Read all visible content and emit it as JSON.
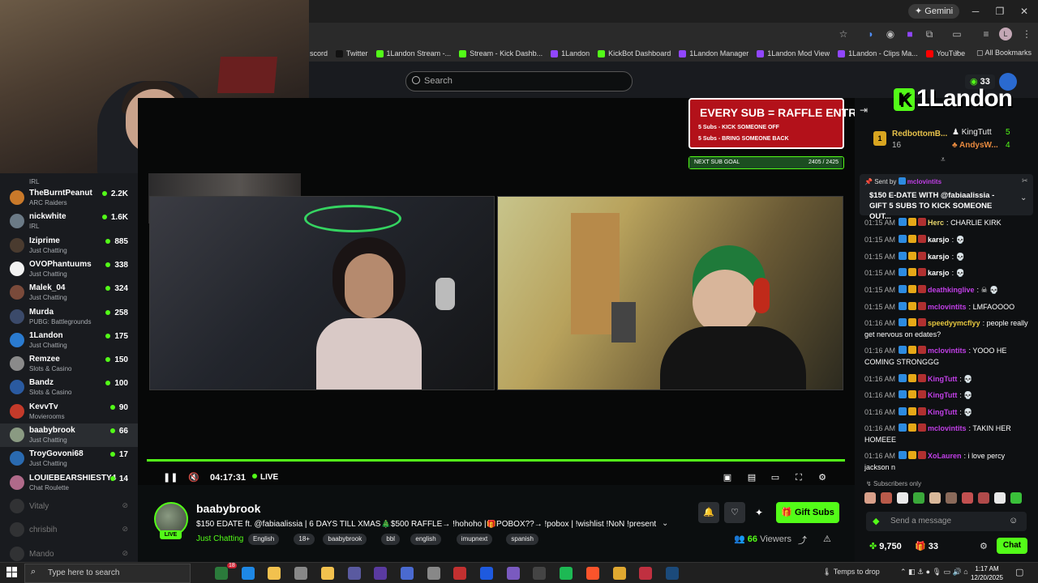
{
  "browser": {
    "gemini_label": "Gemini",
    "bookmarks": [
      {
        "label": "scord",
        "color": "#5865f2"
      },
      {
        "label": "Twitter",
        "color": "#111111"
      },
      {
        "label": "1Landon Stream -...",
        "color": "#53fc18"
      },
      {
        "label": "Stream - Kick Dashb...",
        "color": "#53fc18"
      },
      {
        "label": "1Landon",
        "color": "#9146ff"
      },
      {
        "label": "KickBot Dashboard",
        "color": "#53fc18"
      },
      {
        "label": "1Landon Manager",
        "color": "#9146ff"
      },
      {
        "label": "1Landon Mod View",
        "color": "#9146ff"
      },
      {
        "label": "1Landon - Clips Ma...",
        "color": "#9146ff"
      },
      {
        "label": "YouTube",
        "color": "#ff0000"
      }
    ],
    "all_bookmarks": "All Bookmarks"
  },
  "header": {
    "search_placeholder": "Search"
  },
  "sidebar": {
    "top_category": "IRL",
    "items": [
      {
        "name": "TheBurntPeanut",
        "category": "ARC Raiders",
        "viewers": "2.2K",
        "color": "#c9792a",
        "live": true
      },
      {
        "name": "nickwhite",
        "category": "IRL",
        "viewers": "1.6K",
        "color": "#6b7a86",
        "live": true
      },
      {
        "name": "Iziprime",
        "category": "Just Chatting",
        "viewers": "885",
        "color": "#4a3b2f",
        "live": true
      },
      {
        "name": "OVOPhantuums",
        "category": "Just Chatting",
        "viewers": "338",
        "color": "#f2f2f2",
        "live": true
      },
      {
        "name": "Malek_04",
        "category": "Just Chatting",
        "viewers": "324",
        "color": "#7a4a3a",
        "live": true
      },
      {
        "name": "Murda",
        "category": "PUBG: Battlegrounds",
        "viewers": "258",
        "color": "#3b4a6a",
        "live": true
      },
      {
        "name": "1Landon",
        "category": "Just Chatting",
        "viewers": "175",
        "color": "#2a7bd0",
        "live": true
      },
      {
        "name": "Remzee",
        "category": "Slots & Casino",
        "viewers": "150",
        "color": "#8a8a8a",
        "live": true
      },
      {
        "name": "Bandz",
        "category": "Slots & Casino",
        "viewers": "100",
        "color": "#2a5aa0",
        "live": true
      },
      {
        "name": "KevvTv",
        "category": "Movierooms",
        "viewers": "90",
        "color": "#c43a2a",
        "live": true
      },
      {
        "name": "baabybrook",
        "category": "Just Chatting",
        "viewers": "66",
        "color": "#8a9a82",
        "live": true,
        "active": true
      },
      {
        "name": "TroyGovoni68",
        "category": "Just Chatting",
        "viewers": "17",
        "color": "#2a6ab0",
        "live": true
      },
      {
        "name": "LOUIEBEARSHIESTY4",
        "category": "Chat Roulette",
        "viewers": "14",
        "color": "#b06a8a",
        "live": true
      },
      {
        "name": "Vitaly",
        "category": "",
        "viewers": "",
        "color": "#555555",
        "live": false
      },
      {
        "name": "chrisbih",
        "category": "",
        "viewers": "",
        "color": "#555555",
        "live": false
      },
      {
        "name": "Mando",
        "category": "",
        "viewers": "",
        "color": "#555555",
        "live": false
      }
    ]
  },
  "overlay": {
    "raffle_title": "EVERY SUB = RAFFLE ENTRY",
    "raffle_line1": "5 Subs - KICK SOMEONE OFF",
    "raffle_line2": "5 Subs - BRING SOMEONE BACK",
    "subgoal_label": "NEXT SUB GOAL",
    "subgoal_value": "2405 / 2425",
    "subgoal_progress": 0.99
  },
  "player": {
    "time": "04:17:31",
    "live_label": "LIVE"
  },
  "stream": {
    "name": "baabybrook",
    "live_badge": "LIVE",
    "title": "$150 EDATE ft. @fabiaalissia | 6 DAYS TILL XMAS🎄$500 RAFFLE→ !hohoho |🎁POBOX??→ !pobox | !wishlist !NoN !present ...",
    "category": "Just Chatting",
    "tags": [
      "English",
      "18+",
      "baabybrook",
      "bbl",
      "english",
      "imupnext",
      "spanish"
    ],
    "gift_label": "Gift Subs",
    "viewers": "66",
    "viewers_label": "Viewers"
  },
  "chat": {
    "coins_badge": "33",
    "logo_text": "1Landon",
    "leaderboard": [
      {
        "rank": "1",
        "name": "RedbottomB...",
        "value": "16"
      },
      {
        "name": "KingTutt",
        "value": "5"
      },
      {
        "name": "AndysW...",
        "value": "4"
      }
    ],
    "pinned_sent_by": "Sent by",
    "pinned_user": "mclovintits",
    "pinned_text": "$150 E-DATE WITH @fabiaalissia - GIFT 5 SUBS TO KICK SOMEONE OUT...",
    "messages": [
      {
        "time": "01:15 AM",
        "user": "Herc",
        "user_color": "#e6d46a",
        "text": "CHARLIE KIRK"
      },
      {
        "time": "01:15 AM",
        "user": "karsjo",
        "user_color": "#ffffff",
        "text": "💀"
      },
      {
        "time": "01:15 AM",
        "user": "karsjo",
        "user_color": "#ffffff",
        "text": "💀"
      },
      {
        "time": "01:15 AM",
        "user": "karsjo",
        "user_color": "#ffffff",
        "text": "💀"
      },
      {
        "time": "01:15 AM",
        "user": "deathkinglive",
        "user_color": "#c23fe8",
        "text": "☠ 💀"
      },
      {
        "time": "01:15 AM",
        "user": "mclovintits",
        "user_color": "#c23fe8",
        "text": "LMFAOOOO"
      },
      {
        "time": "01:16 AM",
        "user": "speedyymcflyy",
        "user_color": "#e8c83f",
        "text": "people really get nervous on edates?"
      },
      {
        "time": "01:16 AM",
        "user": "mclovintits",
        "user_color": "#c23fe8",
        "text": "YOOO HE COMING STRONGGG"
      },
      {
        "time": "01:16 AM",
        "user": "KingTutt",
        "user_color": "#c23fe8",
        "text": "💀"
      },
      {
        "time": "01:16 AM",
        "user": "KingTutt",
        "user_color": "#c23fe8",
        "text": "💀"
      },
      {
        "time": "01:16 AM",
        "user": "KingTutt",
        "user_color": "#c23fe8",
        "text": "💀"
      },
      {
        "time": "01:16 AM",
        "user": "mclovintits",
        "user_color": "#c23fe8",
        "text": "TAKIN HER HOMEEE"
      },
      {
        "time": "01:16 AM",
        "user": "XoLauren",
        "user_color": "#c23fe8",
        "text": "i love percy jackson n"
      }
    ],
    "subs_only": "Subscribers only",
    "input_placeholder": "Send a message",
    "points": "9,750",
    "gifts": "33",
    "send_label": "Chat"
  },
  "taskbar": {
    "search_placeholder": "Type here to search",
    "badge": "18",
    "drop_label": "Temps to drop",
    "time": "1:17 AM",
    "date": "12/20/2025"
  }
}
